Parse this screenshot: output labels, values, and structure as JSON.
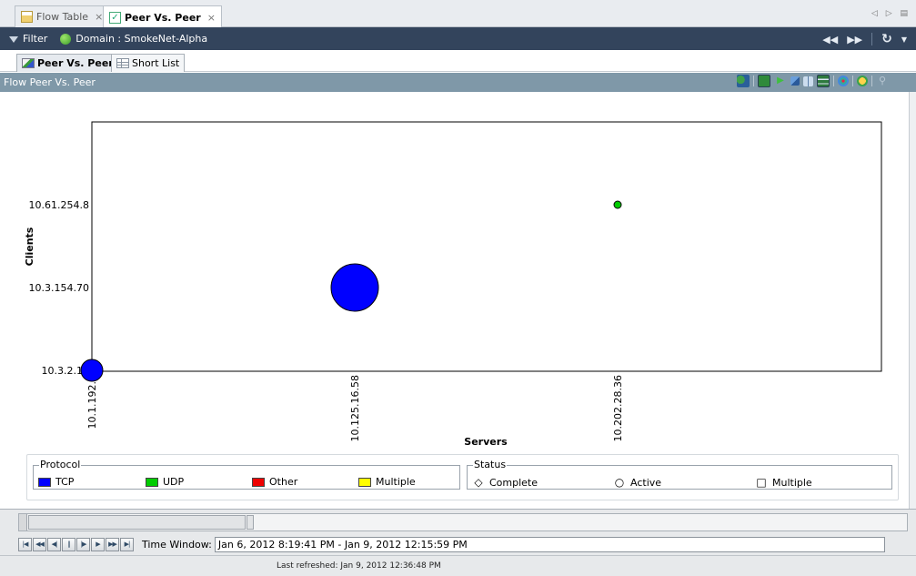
{
  "doc_tabs": [
    {
      "label": "Flow Table",
      "active": false
    },
    {
      "label": "Peer Vs. Peer",
      "active": true
    }
  ],
  "toolbar": {
    "filter_label": "Filter",
    "domain_label": "Domain : SmokeNet-Alpha"
  },
  "view_tabs": [
    {
      "label": "Peer Vs. Peer",
      "active": true
    },
    {
      "label": "Short List",
      "active": false
    }
  ],
  "panel": {
    "title": "Flow Peer Vs. Peer"
  },
  "chart_data": {
    "type": "scatter",
    "title": "",
    "xlabel": "Servers",
    "ylabel": "Clients",
    "x_categories": [
      "10.1.192.5",
      "10.125.16.58",
      "10.202.28.36"
    ],
    "y_categories": [
      "10.3.2.13",
      "10.3.154.70",
      "10.61.254.8"
    ],
    "points": [
      {
        "x": "10.1.192.5",
        "y": "10.3.2.13",
        "protocol": "TCP",
        "status": "Active",
        "size": "medium"
      },
      {
        "x": "10.125.16.58",
        "y": "10.3.154.70",
        "protocol": "TCP",
        "status": "Active",
        "size": "large"
      },
      {
        "x": "10.202.28.36",
        "y": "10.61.254.8",
        "protocol": "UDP",
        "status": "Active",
        "size": "small"
      }
    ],
    "grid": false
  },
  "legend": {
    "protocol_title": "Protocol",
    "protocol_items": [
      {
        "label": "TCP",
        "color": "#0000ff"
      },
      {
        "label": "UDP",
        "color": "#00cc00"
      },
      {
        "label": "Other",
        "color": "#ee0000"
      },
      {
        "label": "Multiple",
        "color": "#ffff00"
      }
    ],
    "status_title": "Status",
    "status_items": [
      {
        "label": "Complete",
        "symbol": "◇"
      },
      {
        "label": "Active",
        "symbol": "○"
      },
      {
        "label": "Multiple",
        "symbol": "□"
      }
    ]
  },
  "timeline": {
    "label": "Time Window:",
    "value": "Jan 6, 2012 8:19:41 PM - Jan 9, 2012 12:15:59 PM"
  },
  "status_bar": {
    "text": "Last refreshed: Jan 9, 2012 12:36:48 PM"
  },
  "colors": {
    "toolbar_bg": "#33445c",
    "panel_header_bg": "#7f98a8",
    "tcp": "#0000ff",
    "udp": "#00cc00"
  }
}
